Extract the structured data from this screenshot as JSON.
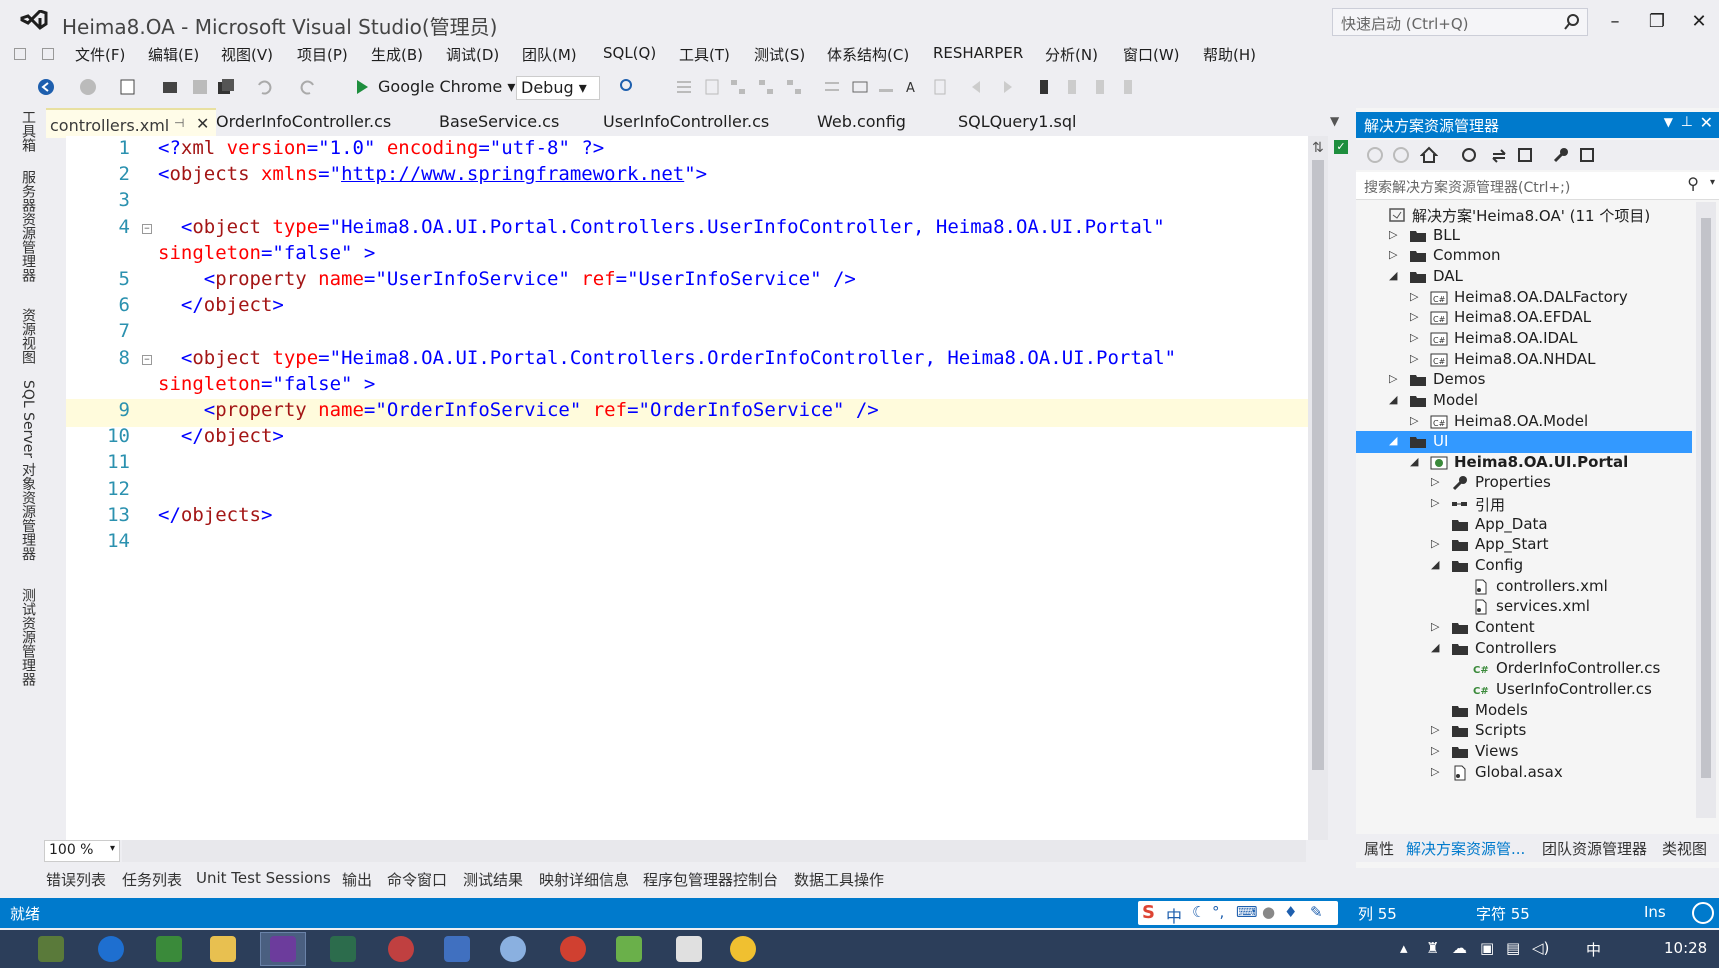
{
  "window": {
    "title": "Heima8.OA - Microsoft Visual Studio(管理员)",
    "quick_launch_placeholder": "快速启动 (Ctrl+Q)",
    "minimize": "–",
    "restore": "❐",
    "close": "✕"
  },
  "menu": [
    "文件(F)",
    "编辑(E)",
    "视图(V)",
    "项目(P)",
    "生成(B)",
    "调试(D)",
    "团队(M)",
    "SQL(Q)",
    "工具(T)",
    "测试(S)",
    "体系结构(C)",
    "RESHARPER",
    "分析(N)",
    "窗口(W)",
    "帮助(H)"
  ],
  "toolbar": {
    "run_target": "Google Chrome",
    "configuration": "Debug"
  },
  "left_strip": [
    "工具箱",
    "服务器资源管理器",
    "资源视图",
    "SQL Server 对象资源管理器",
    "测试资源管理器"
  ],
  "doc_tabs": [
    {
      "label": "controllers.xml",
      "active": true
    },
    {
      "label": "OrderInfoController.cs"
    },
    {
      "label": "BaseService.cs"
    },
    {
      "label": "UserInfoController.cs"
    },
    {
      "label": "Web.config"
    },
    {
      "label": "SQLQuery1.sql"
    }
  ],
  "editor": {
    "zoom": "100 %",
    "lines": [
      {
        "n": "1",
        "segs": [
          [
            "xml-punct",
            "<?"
          ],
          [
            "xml-tag",
            "xml "
          ],
          [
            "xml-attr",
            "version"
          ],
          [
            "xml-punct",
            "=\""
          ],
          [
            "xml-val",
            "1.0"
          ],
          [
            "xml-punct",
            "\" "
          ],
          [
            "xml-attr",
            "encoding"
          ],
          [
            "xml-punct",
            "=\""
          ],
          [
            "xml-val",
            "utf-8"
          ],
          [
            "xml-punct",
            "\" ?>"
          ]
        ]
      },
      {
        "n": "2",
        "segs": [
          [
            "xml-punct",
            "<"
          ],
          [
            "xml-tag",
            "objects "
          ],
          [
            "xml-attr",
            "xmlns"
          ],
          [
            "xml-punct",
            "=\""
          ],
          [
            "xml-link",
            "http://www.springframework.net"
          ],
          [
            "xml-punct",
            "\">"
          ]
        ]
      },
      {
        "n": "3",
        "segs": []
      },
      {
        "n": "4",
        "fold": true,
        "segs": [
          [
            "xml-punct",
            "  <"
          ],
          [
            "xml-tag",
            "object "
          ],
          [
            "xml-attr",
            "type"
          ],
          [
            "xml-punct",
            "=\""
          ],
          [
            "xml-val",
            "Heima8.OA.UI.Portal.Controllers.UserInfoController, Heima8.OA.UI.Portal"
          ],
          [
            "xml-punct",
            "\""
          ]
        ]
      },
      {
        "n": "",
        "segs": [
          [
            "xml-attr",
            "singleton"
          ],
          [
            "xml-punct",
            "=\""
          ],
          [
            "xml-val",
            "false"
          ],
          [
            "xml-punct",
            "\" >"
          ]
        ]
      },
      {
        "n": "5",
        "segs": [
          [
            "xml-punct",
            "    <"
          ],
          [
            "xml-tag",
            "property "
          ],
          [
            "xml-attr",
            "name"
          ],
          [
            "xml-punct",
            "=\""
          ],
          [
            "xml-val",
            "UserInfoService"
          ],
          [
            "xml-punct",
            "\" "
          ],
          [
            "xml-attr",
            "ref"
          ],
          [
            "xml-punct",
            "=\""
          ],
          [
            "xml-val",
            "UserInfoService"
          ],
          [
            "xml-punct",
            "\" />"
          ]
        ]
      },
      {
        "n": "6",
        "segs": [
          [
            "xml-punct",
            "  </"
          ],
          [
            "xml-tag",
            "object"
          ],
          [
            "xml-punct",
            ">"
          ]
        ]
      },
      {
        "n": "7",
        "segs": []
      },
      {
        "n": "8",
        "fold": true,
        "segs": [
          [
            "xml-punct",
            "  <"
          ],
          [
            "xml-tag",
            "object "
          ],
          [
            "xml-attr",
            "type"
          ],
          [
            "xml-punct",
            "=\""
          ],
          [
            "xml-val",
            "Heima8.OA.UI.Portal.Controllers.OrderInfoController, Heima8.OA.UI.Portal"
          ],
          [
            "xml-punct",
            "\""
          ]
        ]
      },
      {
        "n": "",
        "segs": [
          [
            "xml-attr",
            "singleton"
          ],
          [
            "xml-punct",
            "=\""
          ],
          [
            "xml-val",
            "false"
          ],
          [
            "xml-punct",
            "\" >"
          ]
        ]
      },
      {
        "n": "9",
        "current": true,
        "segs": [
          [
            "xml-punct",
            "    <"
          ],
          [
            "xml-tag",
            "property "
          ],
          [
            "xml-attr",
            "name"
          ],
          [
            "xml-punct",
            "=\""
          ],
          [
            "xml-val",
            "OrderInfoService"
          ],
          [
            "xml-punct",
            "\" "
          ],
          [
            "xml-attr",
            "ref"
          ],
          [
            "xml-punct",
            "=\""
          ],
          [
            "xml-val",
            "OrderInfoService"
          ],
          [
            "xml-punct",
            "\" />"
          ]
        ]
      },
      {
        "n": "10",
        "segs": [
          [
            "xml-punct",
            "  </"
          ],
          [
            "xml-tag",
            "object"
          ],
          [
            "xml-punct",
            ">"
          ]
        ]
      },
      {
        "n": "11",
        "segs": []
      },
      {
        "n": "12",
        "segs": []
      },
      {
        "n": "13",
        "segs": [
          [
            "xml-punct",
            "</"
          ],
          [
            "xml-tag",
            "objects"
          ],
          [
            "xml-punct",
            ">"
          ]
        ]
      },
      {
        "n": "14",
        "segs": []
      }
    ]
  },
  "bottom_tabs": [
    "错误列表",
    "任务列表",
    "Unit Test Sessions",
    "输出",
    "命令窗口",
    "测试结果",
    "映射详细信息",
    "程序包管理器控制台",
    "数据工具操作"
  ],
  "solution_explorer": {
    "title": "解决方案资源管理器",
    "search_placeholder": "搜索解决方案资源管理器(Ctrl+;)",
    "tree": [
      {
        "label": "解决方案'Heima8.OA' (11 个项目)",
        "depth": 0,
        "tw": "",
        "icon": "solution"
      },
      {
        "label": "BLL",
        "depth": 1,
        "tw": "▷",
        "icon": "folder"
      },
      {
        "label": "Common",
        "depth": 1,
        "tw": "▷",
        "icon": "folder"
      },
      {
        "label": "DAL",
        "depth": 1,
        "tw": "◢",
        "icon": "folder"
      },
      {
        "label": "Heima8.OA.DALFactory",
        "depth": 2,
        "tw": "▷",
        "icon": "csproj"
      },
      {
        "label": "Heima8.OA.EFDAL",
        "depth": 2,
        "tw": "▷",
        "icon": "csproj"
      },
      {
        "label": "Heima8.OA.IDAL",
        "depth": 2,
        "tw": "▷",
        "icon": "csproj"
      },
      {
        "label": "Heima8.OA.NHDAL",
        "depth": 2,
        "tw": "▷",
        "icon": "csproj"
      },
      {
        "label": "Demos",
        "depth": 1,
        "tw": "▷",
        "icon": "folder"
      },
      {
        "label": "Model",
        "depth": 1,
        "tw": "◢",
        "icon": "folder"
      },
      {
        "label": "Heima8.OA.Model",
        "depth": 2,
        "tw": "▷",
        "icon": "csproj"
      },
      {
        "label": "UI",
        "depth": 1,
        "tw": "◢",
        "icon": "folder",
        "selected": true
      },
      {
        "label": "Heima8.OA.UI.Portal",
        "depth": 2,
        "tw": "◢",
        "icon": "webproj",
        "bold": true
      },
      {
        "label": "Properties",
        "depth": 3,
        "tw": "▷",
        "icon": "wrench"
      },
      {
        "label": "引用",
        "depth": 3,
        "tw": "▷",
        "icon": "refs"
      },
      {
        "label": "App_Data",
        "depth": 3,
        "tw": "",
        "icon": "folder"
      },
      {
        "label": "App_Start",
        "depth": 3,
        "tw": "▷",
        "icon": "folder"
      },
      {
        "label": "Config",
        "depth": 3,
        "tw": "◢",
        "icon": "folder"
      },
      {
        "label": "controllers.xml",
        "depth": 4,
        "tw": "",
        "icon": "xmlfile"
      },
      {
        "label": "services.xml",
        "depth": 4,
        "tw": "",
        "icon": "xmlfile"
      },
      {
        "label": "Content",
        "depth": 3,
        "tw": "▷",
        "icon": "folder"
      },
      {
        "label": "Controllers",
        "depth": 3,
        "tw": "◢",
        "icon": "folder"
      },
      {
        "label": "OrderInfoController.cs",
        "depth": 4,
        "tw": "",
        "icon": "csfile"
      },
      {
        "label": "UserInfoController.cs",
        "depth": 4,
        "tw": "",
        "icon": "csfile"
      },
      {
        "label": "Models",
        "depth": 3,
        "tw": "",
        "icon": "folder"
      },
      {
        "label": "Scripts",
        "depth": 3,
        "tw": "▷",
        "icon": "folder"
      },
      {
        "label": "Views",
        "depth": 3,
        "tw": "▷",
        "icon": "folder"
      },
      {
        "label": "Global.asax",
        "depth": 3,
        "tw": "▷",
        "icon": "xmlfile"
      }
    ],
    "bottom_tabs": [
      {
        "label": "属性"
      },
      {
        "label": "解决方案资源管...",
        "active": true
      },
      {
        "label": "团队资源管理器"
      },
      {
        "label": "类视图"
      }
    ]
  },
  "status": {
    "ready": "就绪",
    "col": "列 55",
    "char": "字符 55",
    "ins": "Ins"
  },
  "ime": {
    "lang": "中"
  },
  "taskbar": {
    "time": "10:28",
    "ime": "中"
  },
  "colors": {
    "accent": "#007acc",
    "selected": "#3399ff",
    "xml_tag": "#a31515",
    "xml_attr": "#ff0000",
    "xml_value": "#0000ff",
    "line_number": "#2b91af"
  }
}
